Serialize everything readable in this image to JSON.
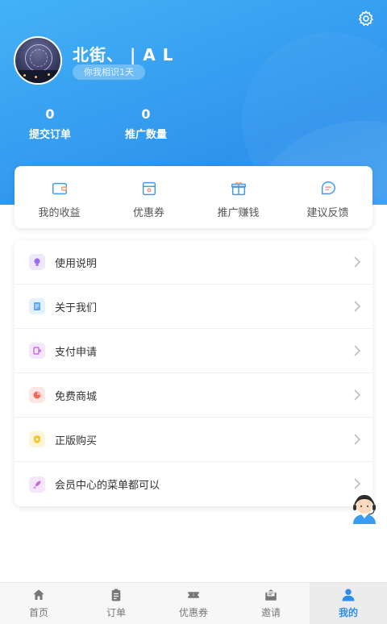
{
  "profile": {
    "name": "北街、 | A L",
    "since": "你我相识1天"
  },
  "stats": [
    {
      "value": "0",
      "label": "提交订单"
    },
    {
      "value": "0",
      "label": "推广数量"
    }
  ],
  "quick_actions": [
    {
      "label": "我的收益",
      "icon": "wallet-icon"
    },
    {
      "label": "优惠券",
      "icon": "coupon-icon"
    },
    {
      "label": "推广赚钱",
      "icon": "gift-icon"
    },
    {
      "label": "建议反馈",
      "icon": "chat-icon"
    }
  ],
  "menu": [
    {
      "label": "使用说明",
      "icon": "lightbulb-icon",
      "color": "#9b6cf2"
    },
    {
      "label": "关于我们",
      "icon": "document-icon",
      "color": "#5aa6f3"
    },
    {
      "label": "支付申请",
      "icon": "payment-icon",
      "color": "#c76be8"
    },
    {
      "label": "免费商城",
      "icon": "pie-chart-icon",
      "color": "#f06a5a"
    },
    {
      "label": "正版购买",
      "icon": "shield-icon",
      "color": "#f3c531"
    },
    {
      "label": "会员中心的菜单都可以",
      "icon": "rocket-icon",
      "color": "#c56ae6"
    }
  ],
  "tabs": [
    {
      "label": "首页",
      "icon": "home-icon",
      "active": false
    },
    {
      "label": "订单",
      "icon": "clipboard-icon",
      "active": false
    },
    {
      "label": "优惠券",
      "icon": "ticket-icon",
      "active": false
    },
    {
      "label": "邀请",
      "icon": "envelope-icon",
      "active": false
    },
    {
      "label": "我的",
      "icon": "user-icon",
      "active": true
    }
  ],
  "colors": {
    "header_start": "#43b2f7",
    "header_end": "#2f93ec",
    "accent": "#2d8ee8"
  }
}
